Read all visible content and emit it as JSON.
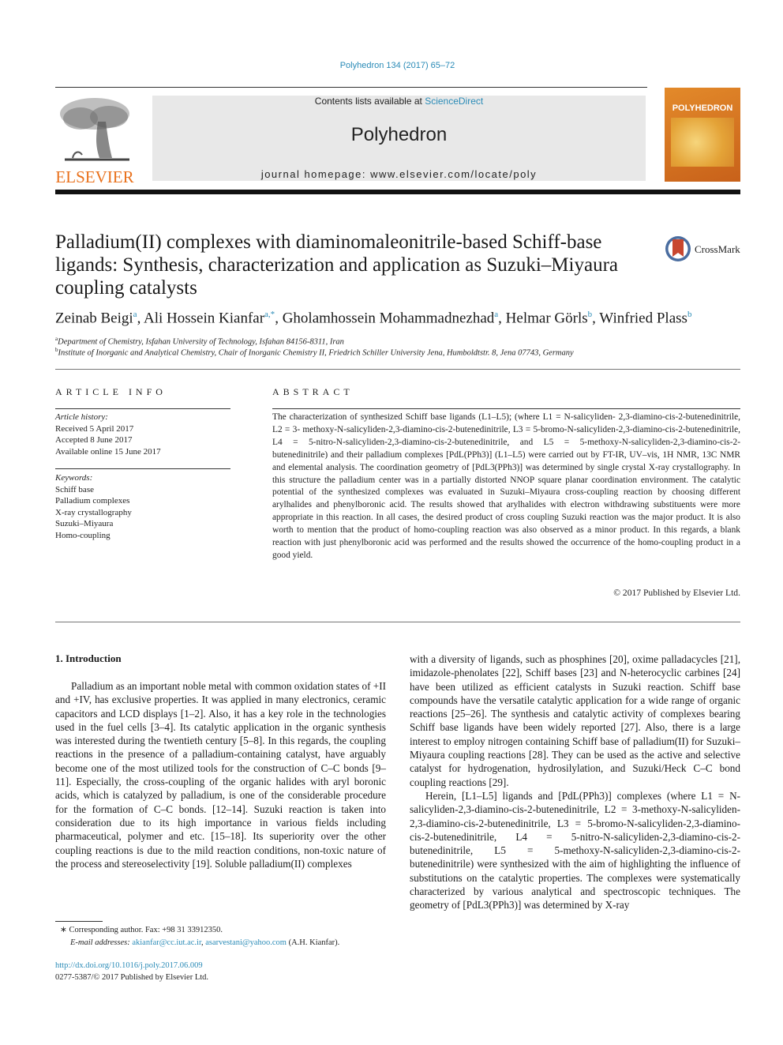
{
  "header": {
    "journal_ref": "Polyhedron 134 (2017) 65–72",
    "contents_prefix": "Contents lists available at ",
    "contents_link": "ScienceDirect",
    "journal_title": "Polyhedron",
    "homepage": "journal homepage: www.elsevier.com/locate/poly",
    "publisher_logo": "ELSEVIER",
    "cover_title": "POLYHEDRON"
  },
  "article": {
    "title_lines": [
      "Palladium(II) complexes with diaminomaleonitrile-based Schiff-base",
      "ligands: Synthesis, characterization and application as Suzuki–Miyaura",
      "coupling catalysts"
    ],
    "crossmark_label": "CrossMark",
    "authors": [
      {
        "name": "Zeinab Beigi",
        "aff": "a"
      },
      {
        "name": "Ali Hossein Kianfar",
        "aff": "a,*"
      },
      {
        "name": "Gholamhossein Mohammadnezhad",
        "aff": "a"
      },
      {
        "name": "Helmar Görls",
        "aff": "b"
      },
      {
        "name": "Winfried Plass",
        "aff": "b"
      }
    ],
    "affiliations": [
      {
        "key": "a",
        "text": "Department of Chemistry, Isfahan University of Technology, Isfahan 84156-8311, Iran"
      },
      {
        "key": "b",
        "text": "Institute of Inorganic and Analytical Chemistry, Chair of Inorganic Chemistry II, Friedrich Schiller University Jena, Humboldtstr. 8, Jena 07743, Germany"
      }
    ]
  },
  "article_info": {
    "heading": "ARTICLE INFO",
    "history_label": "Article history:",
    "history": [
      "Received 5 April 2017",
      "Accepted 8 June 2017",
      "Available online 15 June 2017"
    ],
    "keywords_label": "Keywords:",
    "keywords": [
      "Schiff base",
      "Palladium complexes",
      "X-ray crystallography",
      "Suzuki–Miyaura",
      "Homo-coupling"
    ]
  },
  "abstract": {
    "heading": "ABSTRACT",
    "text": "The characterization of synthesized Schiff base ligands (L1–L5); (where L1 = N-salicyliden- 2,3-diamino-cis-2-butenedinitrile, L2 = 3- methoxy-N-salicyliden-2,3-diamino-cis-2-butenedinitrile, L3 = 5-bromo-N-salicyliden-2,3-diamino-cis-2-butenedinitrile, L4 = 5-nitro-N-salicyliden-2,3-diamino-cis-2-butenedinitrile, and L5 = 5-methoxy-N-salicyliden-2,3-diamino-cis-2-butenedinitrile) and their palladium complexes [PdL(PPh3)] (L1–L5) were carried out by FT-IR, UV–vis, 1H NMR, 13C NMR and elemental analysis. The coordination geometry of [PdL3(PPh3)] was determined by single crystal X-ray crystallography. In this structure the palladium center was in a partially distorted NNOP square planar coordination environment. The catalytic potential of the synthesized complexes was evaluated in Suzuki–Miyaura cross-coupling reaction by choosing different arylhalides and phenylboronic acid. The results showed that arylhalides with electron withdrawing substituents were more appropriate in this reaction. In all cases, the desired product of cross coupling Suzuki reaction was the major product. It is also worth to mention that the product of homo-coupling reaction was also observed as a minor product. In this regards, a blank reaction with just phenylboronic acid was performed and the results showed the occurrence of the homo-coupling product in a good yield.",
    "copyright": "© 2017 Published by Elsevier Ltd."
  },
  "body": {
    "section_heading": "1. Introduction",
    "left_paragraph": "Palladium as an important noble metal with common oxidation states of +II and +IV, has exclusive properties. It was applied in many electronics, ceramic capacitors and LCD displays [1–2]. Also, it has a key role in the technologies used in the fuel cells [3–4]. Its catalytic application in the organic synthesis was interested during the twentieth century [5–8]. In this regards, the coupling reactions in the presence of a palladium-containing catalyst, have arguably become one of the most utilized tools for the construction of C–C bonds [9–11]. Especially, the cross-coupling of the organic halides with aryl boronic acids, which is catalyzed by palladium, is one of the considerable procedure for the formation of C–C bonds. [12–14]. Suzuki reaction is taken into consideration due to its high importance in various fields including pharmaceutical, polymer and etc. [15–18]. Its superiority over the other coupling reactions is due to the mild reaction conditions, non-toxic nature of the process and stereoselectivity [19]. Soluble palladium(II) complexes",
    "right_paragraph_1": "with a diversity of ligands, such as phosphines [20], oxime palladacycles [21], imidazole-phenolates [22], Schiff bases [23] and N-heterocyclic carbines [24] have been utilized as efficient catalysts in Suzuki reaction. Schiff base compounds have the versatile catalytic application for a wide range of organic reactions [25–26]. The synthesis and catalytic activity of complexes bearing Schiff base ligands have been widely reported [27]. Also, there is a large interest to employ nitrogen containing Schiff base of palladium(II) for Suzuki–Miyaura coupling reactions [28]. They can be used as the active and selective catalyst for hydrogenation, hydrosilylation, and Suzuki/Heck C–C bond coupling reactions [29].",
    "right_paragraph_2": "Herein, [L1–L5] ligands and [PdL(PPh3)] complexes (where L1 = N-salicyliden-2,3-diamino-cis-2-butenedinitrile, L2 = 3-methoxy-N-salicyliden-2,3-diamino-cis-2-butenedinitrile, L3 = 5-bromo-N-salicyliden-2,3-diamino-cis-2-butenedinitrile, L4 = 5-nitro-N-salicyliden-2,3-diamino-cis-2-butenedinitrile, L5 = 5-methoxy-N-salicyliden-2,3-diamino-cis-2-butenedinitrile) were synthesized with the aim of highlighting the influence of substitutions on the catalytic properties. The complexes were systematically characterized by various analytical and spectroscopic techniques. The geometry of [PdL3(PPh3)] was determined by X-ray"
  },
  "footnotes": {
    "corresponding": "Corresponding author. Fax: +98 31 33912350.",
    "email_label": "E-mail addresses:",
    "emails": [
      "akianfar@cc.iut.ac.ir",
      "asarvestani@yahoo.com"
    ],
    "email_suffix": "(A.H. Kianfar).",
    "doi": "http://dx.doi.org/10.1016/j.poly.2017.06.009",
    "issn": "0277-5387/© 2017 Published by Elsevier Ltd."
  },
  "colors": {
    "link": "#2a8bb7",
    "elsevier_orange": "#e9711c",
    "masthead_bg": "#e8e8e8"
  }
}
